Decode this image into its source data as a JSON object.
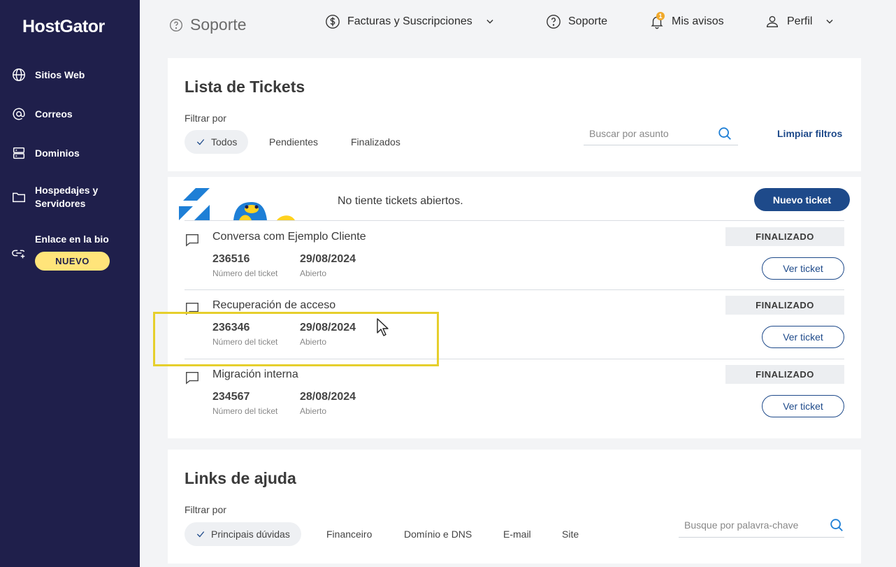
{
  "brand": {
    "logo": "HostGator"
  },
  "sidebar": {
    "items": [
      {
        "label": "Sitios Web",
        "icon": "globe-icon"
      },
      {
        "label": "Correos",
        "icon": "at-icon"
      },
      {
        "label": "Dominios",
        "icon": "server-icon"
      },
      {
        "label": "Hospedajes y Servidores",
        "icon": "folder-icon"
      },
      {
        "label": "Enlace en la bio",
        "icon": "link-icon"
      }
    ],
    "new_badge": "NUEVO"
  },
  "topbar": {
    "page_title": "Soporte",
    "billing": "Facturas y Suscripciones",
    "support": "Soporte",
    "notifications": "Mis avisos",
    "notifications_count": "1",
    "profile": "Perfil"
  },
  "tickets_card": {
    "title": "Lista de Tickets",
    "filter_label": "Filtrar por",
    "filters": [
      "Todos",
      "Pendientes",
      "Finalizados"
    ],
    "active_filter": "Todos",
    "search_placeholder": "Buscar por asunto",
    "clear_filters": "Limpiar filtros"
  },
  "tickets": {
    "empty_message": "No tiente tickets abiertos.",
    "new_ticket": "Nuevo ticket",
    "number_label": "Número del ticket",
    "opened_label": "Abierto",
    "view_label": "Ver ticket",
    "items": [
      {
        "subject": "Conversa com Ejemplo Cliente",
        "number": "236516",
        "date": "29/08/2024",
        "status": "FINALIZADO"
      },
      {
        "subject": "Recuperación de acceso",
        "number": "236346",
        "date": "29/08/2024",
        "status": "FINALIZADO"
      },
      {
        "subject": "Migración interna",
        "number": "234567",
        "date": "28/08/2024",
        "status": "FINALIZADO"
      }
    ]
  },
  "help_card": {
    "title": "Links de ajuda",
    "filter_label": "Filtrar por",
    "filters": [
      "Principais dúvidas",
      "Financeiro",
      "Domínio e DNS",
      "E-mail",
      "Site"
    ],
    "active_filter": "Principais dúvidas",
    "search_placeholder": "Busque por palavra-chave"
  },
  "colors": {
    "sidebar": "#1f1f4b",
    "accent": "#1e4a8a",
    "badge": "#ffe47a",
    "highlight": "#e6cf2c"
  }
}
